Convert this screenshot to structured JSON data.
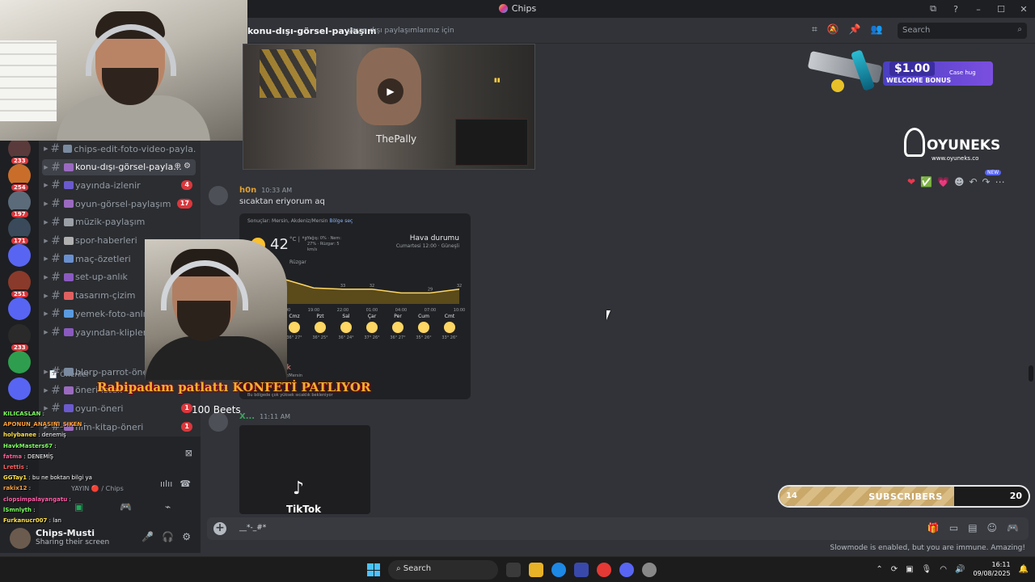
{
  "window": {
    "title": "Chips",
    "controls": [
      "⧉",
      "?",
      "–",
      "☐",
      "✕"
    ]
  },
  "servers": [
    {
      "badge": "233"
    },
    {
      "badge": "254"
    },
    {
      "badge": "197"
    },
    {
      "badge": "171"
    },
    {
      "badge": ""
    },
    {
      "badge": "251"
    },
    {
      "badge": ""
    },
    {
      "badge": "233"
    },
    {
      "badge": ""
    },
    {
      "badge": ""
    }
  ],
  "channels": [
    {
      "label": "chips-edit-foto-video-payla...",
      "count": "",
      "active": false
    },
    {
      "label": "konu-dışı-görsel-payla...",
      "count": "",
      "active": true
    },
    {
      "label": "yayında-izlenir",
      "count": "4",
      "active": false
    },
    {
      "label": "oyun-görsel-paylaşım",
      "count": "17",
      "active": false
    },
    {
      "label": "müzik-paylaşım",
      "count": "",
      "active": false
    },
    {
      "label": "spor-haberleri",
      "count": "",
      "active": false
    },
    {
      "label": "maç-özetleri",
      "count": "",
      "active": false
    },
    {
      "label": "set-up-anlık",
      "count": "",
      "active": false
    },
    {
      "label": "tasarım-çizim",
      "count": "",
      "active": false
    },
    {
      "label": "yemek-foto-anlık",
      "count": "",
      "active": false
    },
    {
      "label": "yayından-klipler",
      "count": "",
      "active": false
    }
  ],
  "category": "Öneriler",
  "oneriler": [
    {
      "label": "blerp-parrot-öneri",
      "count": ""
    },
    {
      "label": "öneri-istek",
      "count": ""
    },
    {
      "label": "oyun-öneri",
      "count": "1"
    },
    {
      "label": "film-kitap-öneri",
      "count": "1"
    }
  ],
  "voice": {
    "status": "YAYIN",
    "channel": "/ Chips"
  },
  "user": {
    "name": "Chips-Musti",
    "status": "Sharing their screen"
  },
  "topbar": {
    "channel": "konu-dışı-görsel-paylaşım",
    "topic": "yayın dışı paylaşımlarınız için",
    "search_placeholder": "Search"
  },
  "video": {
    "caption": "ThePally"
  },
  "messages": [
    {
      "author": "h0n",
      "time": "10:33 AM",
      "text": "sıcaktan eriyorum aq"
    },
    {
      "author": "X...",
      "time": "11:11 AM",
      "text": ""
    }
  ],
  "weather": {
    "location": "Sonuçlar: Mersin, Akdeniz/Mersin",
    "location_link": "Bölge seç",
    "temp": "42",
    "unit": "°C | °F",
    "details": "Yağış: 0% · Nem: 27% · Rüzgar: 5 km/s",
    "heading": "Hava durumu",
    "subheading": "Cumartesi 12:00 · Güneşli",
    "tab": "Rüzgar",
    "days": [
      {
        "name": "Cmz",
        "temps": "36° 27°"
      },
      {
        "name": "Pzt",
        "temps": "36° 25°"
      },
      {
        "name": "Sal",
        "temps": "36° 24°"
      },
      {
        "name": "Çar",
        "temps": "37° 26°"
      },
      {
        "name": "Per",
        "temps": "36° 27°"
      },
      {
        "name": "Cum",
        "temps": "35° 26°"
      },
      {
        "name": "Cmt",
        "temps": "33° 26°"
      }
    ],
    "alert": "Sıcak",
    "alert_location": "Akdeniz/Mersin",
    "footer": "Bu bölgede çok yüksek sıcaklık bekleniyor"
  },
  "weather_chart": {
    "type": "line",
    "categories": [
      "13:00",
      "16:00",
      "19:00",
      "22:00",
      "01:00",
      "04:00",
      "07:00",
      "10:00"
    ],
    "values": [
      42,
      40,
      33,
      32,
      32,
      29,
      29,
      32
    ],
    "labels": [
      "",
      "",
      "",
      "33",
      "32",
      "",
      "29",
      "32"
    ],
    "ylim": [
      20,
      45
    ]
  },
  "overlay": {
    "konfeti": "Rabipadam patlattı KONFETİ PATLIYOR",
    "beets": "100 Beets"
  },
  "tiktok": {
    "label": "TikTok"
  },
  "ad": {
    "amount": "$1.00",
    "text": "WELCOME BONUS",
    "brand": "Case hug"
  },
  "oyuneks": {
    "name": "OYUNEKS",
    "url": "www.oyuneks.co"
  },
  "reactions": {
    "new_label": "NEW",
    "emojis": [
      "❤",
      "✅",
      "💗",
      "☻",
      "↶",
      "↷",
      "⋯"
    ]
  },
  "chat": [
    {
      "user": "KILICASLAN",
      "msg": "",
      "color": "#7cff5e"
    },
    {
      "user": "APONUN_ANASINI_SIKEN",
      "msg": "",
      "color": "#ff9f3a"
    },
    {
      "user": "holybanee",
      "msg": "denemiş",
      "color": "#ffe14a"
    },
    {
      "user": "HavkMasters67",
      "msg": "",
      "color": "#7cff5e"
    },
    {
      "user": "fatma",
      "msg": "DENEMİŞ",
      "color": "#ff5e9a"
    },
    {
      "user": "Lrettis",
      "msg": "",
      "color": "#ff5e5e"
    },
    {
      "user": "GGTay1",
      "msg": "bu ne boktan bilgi ya",
      "color": "#ffe14a"
    },
    {
      "user": "rakix12",
      "msg": "",
      "color": "#ff9f3a"
    },
    {
      "user": "clopsimpalayangatu",
      "msg": "",
      "color": "#ff5ea8"
    },
    {
      "user": "lSmnlyth",
      "msg": "",
      "color": "#7cff5e"
    },
    {
      "user": "Furkanucr007",
      "msg": "lan",
      "color": "#ffe14a"
    }
  ],
  "composer": {
    "text": "__*-_#*"
  },
  "slowmode": "Slowmode is enabled, but you are immune. Amazing!",
  "subscribers": {
    "current": "14",
    "label": "SUBSCRIBERS",
    "goal": "20",
    "progress": 0.7
  },
  "taskbar": {
    "search": "Search",
    "time": "16:11",
    "date": "09/08/2025"
  },
  "colors": {
    "bg": "#313338",
    "sidebar": "#2b2d31",
    "server": "#1e1f22",
    "accent": "#5865f2",
    "badge": "#da373c"
  }
}
